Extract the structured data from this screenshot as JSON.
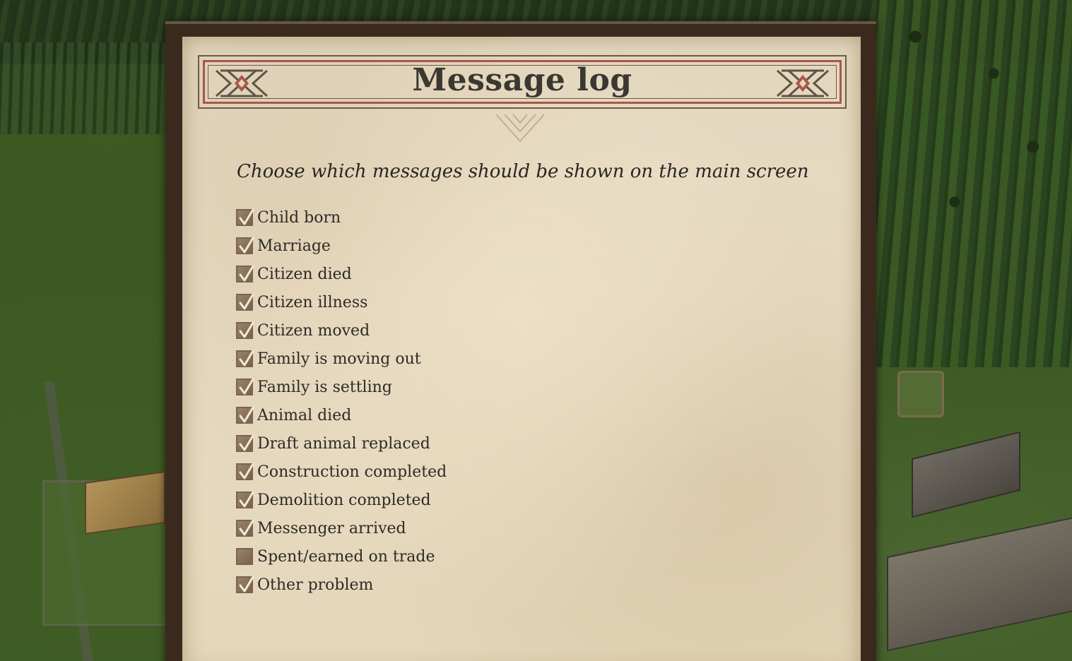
{
  "panel": {
    "title": "Message log",
    "subtitle": "Choose which messages should be shown on the main screen"
  },
  "options": [
    {
      "label": "Child born",
      "checked": true
    },
    {
      "label": "Marriage",
      "checked": true
    },
    {
      "label": "Citizen died",
      "checked": true
    },
    {
      "label": "Citizen illness",
      "checked": true
    },
    {
      "label": "Citizen moved",
      "checked": true
    },
    {
      "label": "Family is moving out",
      "checked": true
    },
    {
      "label": "Family is settling",
      "checked": true
    },
    {
      "label": "Animal died",
      "checked": true
    },
    {
      "label": "Draft animal replaced",
      "checked": true
    },
    {
      "label": "Construction completed",
      "checked": true
    },
    {
      "label": "Demolition completed",
      "checked": true
    },
    {
      "label": "Messenger arrived",
      "checked": true
    },
    {
      "label": "Spent/earned on trade",
      "checked": false
    },
    {
      "label": "Other problem",
      "checked": true
    }
  ],
  "colors": {
    "parchment": "#e4d6b9",
    "frame": "#3a2a1e",
    "accent_red": "#a9574a",
    "text": "#2e2a26",
    "checkbox": "#8a735c",
    "checkmark": "#f2eadb"
  },
  "icons": {
    "header_ornament": "diamond-knot-ornament-icon",
    "checkmark": "checkmark-icon",
    "chevron": "chevron-down-ornament-icon"
  }
}
